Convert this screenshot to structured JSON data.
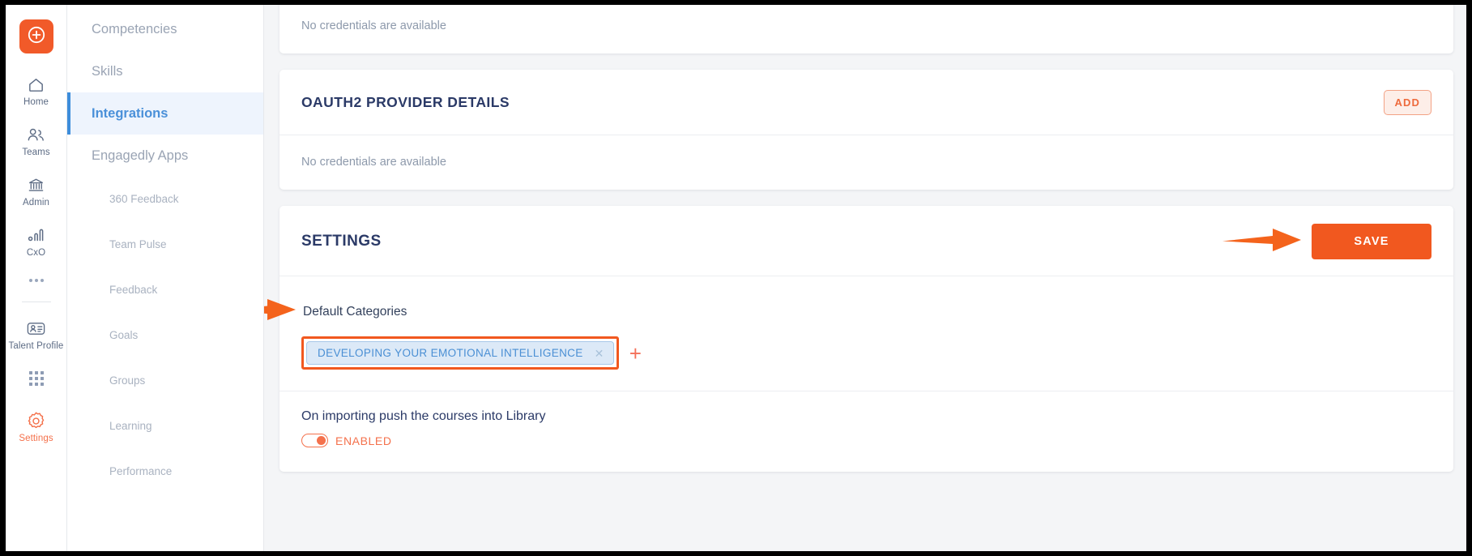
{
  "rail": {
    "logo_icon": "circled-plus-logo-icon",
    "items": [
      {
        "label": "Home",
        "icon": "home-icon",
        "active": false
      },
      {
        "label": "Teams",
        "icon": "teams-icon",
        "active": false
      },
      {
        "label": "Admin",
        "icon": "admin-bank-icon",
        "active": false
      },
      {
        "label": "CxO",
        "icon": "bar-chart-icon",
        "active": false
      },
      {
        "label": "Talent Profile",
        "icon": "talent-profile-icon",
        "active": false
      },
      {
        "label": "Settings",
        "icon": "gear-icon",
        "active": true
      }
    ],
    "more_icon": "ellipsis-icon",
    "apps_icon": "app-grid-icon"
  },
  "subnav": {
    "items": [
      {
        "label": "Competencies",
        "active": false,
        "sub": false
      },
      {
        "label": "Skills",
        "active": false,
        "sub": false
      },
      {
        "label": "Integrations",
        "active": true,
        "sub": false
      },
      {
        "label": "Engagedly Apps",
        "active": false,
        "sub": false
      },
      {
        "label": "360 Feedback",
        "active": false,
        "sub": true
      },
      {
        "label": "Team Pulse",
        "active": false,
        "sub": true
      },
      {
        "label": "Feedback",
        "active": false,
        "sub": true
      },
      {
        "label": "Goals",
        "active": false,
        "sub": true
      },
      {
        "label": "Groups",
        "active": false,
        "sub": true
      },
      {
        "label": "Learning",
        "active": false,
        "sub": true
      },
      {
        "label": "Performance",
        "active": false,
        "sub": true
      }
    ]
  },
  "main": {
    "top_card": {
      "message": "No credentials are available"
    },
    "oauth_card": {
      "title": "OAUTH2 PROVIDER DETAILS",
      "add_label": "ADD",
      "message": "No credentials are available"
    },
    "settings_card": {
      "title": "SETTINGS",
      "save_label": "SAVE",
      "default_categories_label": "Default Categories",
      "chips": [
        {
          "label": "DEVELOPING YOUR EMOTIONAL INTELLIGENCE",
          "remove_icon": "close-icon"
        }
      ],
      "add_category_icon": "plus-icon",
      "toggle_label": "On importing push the courses into Library",
      "toggle_state": "ENABLED",
      "toggle_on": true
    }
  },
  "colors": {
    "accent_orange": "#f1581f",
    "toggle_orange": "#f4714c",
    "chip_blue": "#4a8fd4",
    "chip_bg": "#dce9f7",
    "title_navy": "#2b3a67",
    "nav_active_blue": "#4a90d9",
    "page_bg": "#f4f5f7"
  },
  "annotations": {
    "save_arrow": "orange-arrow-pointing-right",
    "default_categories_arrow": "orange-arrow-pointing-right",
    "chip_highlight": "orange-highlight-box"
  }
}
